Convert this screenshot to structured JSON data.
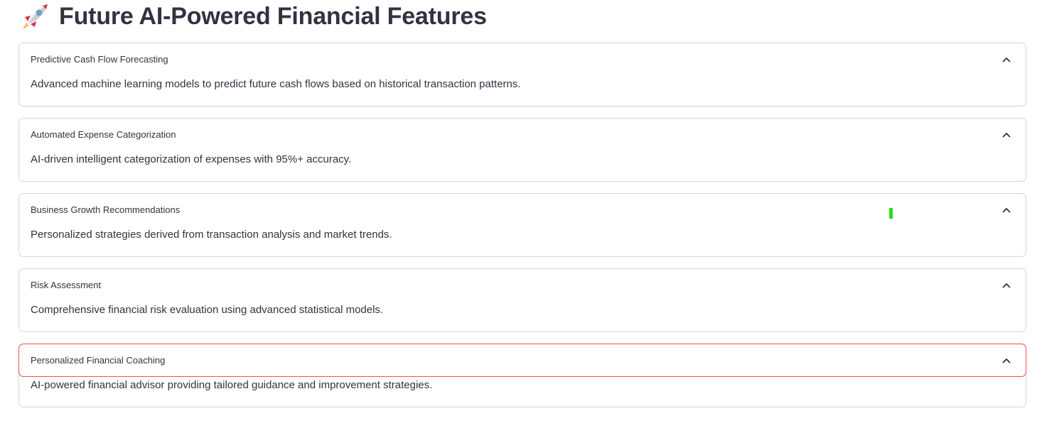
{
  "page": {
    "title_icon": "rocket-icon",
    "title": "Future AI-Powered Financial Features"
  },
  "colors": {
    "text": "#31333f",
    "border": "#d6d6d9",
    "focus_border": "#ff4b4b",
    "cursor_marker": "#22e022"
  },
  "expanders": [
    {
      "label": "Predictive Cash Flow Forecasting",
      "content": "Advanced machine learning models to predict future cash flows based on historical transaction patterns.",
      "expanded": true,
      "icon": "chevron-up-icon"
    },
    {
      "label": "Automated Expense Categorization",
      "content": "AI-driven intelligent categorization of expenses with 95%+ accuracy.",
      "expanded": true,
      "icon": "chevron-up-icon"
    },
    {
      "label": "Business Growth Recommendations",
      "content": "Personalized strategies derived from transaction analysis and market trends.",
      "expanded": true,
      "icon": "chevron-up-icon"
    },
    {
      "label": "Risk Assessment",
      "content": "Comprehensive financial risk evaluation using advanced statistical models.",
      "expanded": true,
      "icon": "chevron-up-icon"
    },
    {
      "label": "Personalized Financial Coaching",
      "content": "AI-powered financial advisor providing tailored guidance and improvement strategies.",
      "expanded": true,
      "focused": true,
      "icon": "chevron-up-icon"
    }
  ]
}
